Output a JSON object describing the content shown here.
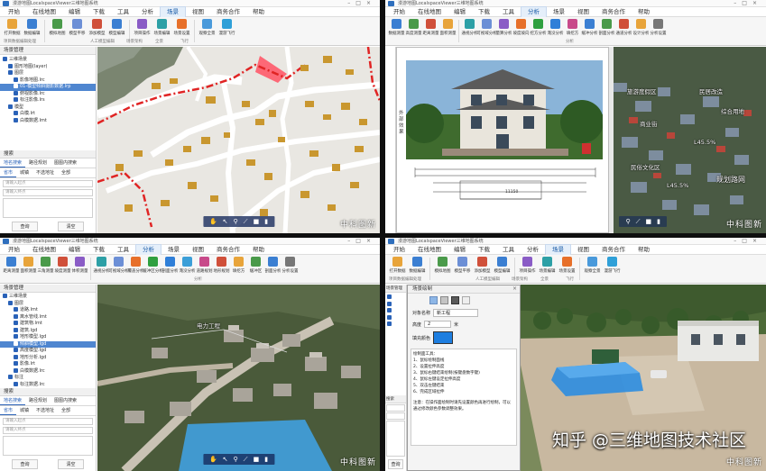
{
  "colors": {
    "accent": "#2a62b8",
    "selection": "#4f86d0",
    "redline": "#e02424"
  },
  "app_title": "漫游地图LocalspaceViewer三维地图系统",
  "menu": [
    "开始",
    "在线地图",
    "编辑",
    "下载",
    "工具",
    "分析",
    "场景",
    "视图",
    "商务合作",
    "帮助"
  ],
  "q1": {
    "active_tab": "场景",
    "ribbon": [
      "打开数据",
      "数据编辑",
      "模拟地图",
      "模型平移",
      "添加模型",
      "模型编辑",
      "项目操作",
      "场景编辑",
      "场景设置",
      "观察全景",
      "漫游飞行"
    ],
    "groups": [
      "项目数据编辑处理",
      "人工模型编辑",
      "场景架构",
      "全景",
      "飞行"
    ],
    "panel_title": "场景管理",
    "tree": [
      "三维场景",
      "图形地图(layer)",
      "图层",
      "影像地图.lrc",
      "01-模型倾斜摄影数据.lrp",
      "俯视影像.lrc",
      "标注影像.lrs",
      "模型",
      "白模.lrt",
      "白模数据.lmt"
    ],
    "selected_index": 4,
    "search_title": "搜索",
    "search_tabs": [
      "地名搜索",
      "路径规划",
      "图图内搜索"
    ],
    "search_sub": [
      "省市",
      "城镇",
      "不选地址",
      "全部"
    ],
    "fields": [
      "请输入起点",
      "请输入终点"
    ],
    "btns": [
      "查询",
      "清空"
    ],
    "nav_icons": [
      "✋",
      "↖",
      "⚲",
      "⟋",
      "■",
      "▮"
    ],
    "watermark": "中科图新"
  },
  "q2": {
    "active_tab": "分析",
    "ribbon": [
      "数据测量",
      "高度测量",
      "距离测量",
      "面积测量",
      "通视分析",
      "可视域分析",
      "量算分析",
      "坡度坡向",
      "挖方分析",
      "淹没分析",
      "填挖方",
      "缓冲分析",
      "剖面分析",
      "通道分析",
      "设计分析",
      "分析设置"
    ],
    "group": "分析",
    "doc_side": "外部效果",
    "drawing_dim": "11150",
    "labels": [
      "旅游度假区",
      "民居改造",
      "商业街",
      "L45.5%",
      "L45.5%",
      "民俗文化区",
      "规划路网",
      "综合用地"
    ],
    "nav_icons": [
      "⚲",
      "⟋",
      "■",
      "▮"
    ],
    "watermark": "中科图新"
  },
  "q3": {
    "active_tab": "分析",
    "ribbon": [
      "距离测量",
      "面积测量",
      "三角测量",
      "坡度测量",
      "体积测量",
      "通视测量",
      "量算",
      "挖方测量",
      "通视分析",
      "可视域分析",
      "覆盖分析",
      "缓冲区分析",
      "剖面分析",
      "淹没分析",
      "道路规划",
      "地形规划",
      "填挖方",
      "缓冲区",
      "剖面分析",
      "分析设置"
    ],
    "group": "分析",
    "panel_title": "场景管理",
    "tree": [
      "三维场景",
      "图层",
      "道路.lmt",
      "离水管线.lmt",
      "建筑物.lmt",
      "建筑.lgd",
      "地形模型.lgd",
      "倾斜模型.lgd",
      "高度模型.lgd",
      "地形分析.lgd",
      "影像.lrt",
      "白模数据.lrc",
      "标注",
      "标注数据.lrc"
    ],
    "selected_index": 7,
    "label": "电力工程",
    "search_title": "搜索",
    "search_tabs": [
      "地名搜索",
      "路径规划",
      "图图内搜索"
    ],
    "search_sub": [
      "省市",
      "城镇",
      "不选地址",
      "全部"
    ],
    "fields": [
      "请输入起点",
      "请输入终点"
    ],
    "btns": [
      "查询",
      "清空"
    ],
    "nav_icons": [
      "✋",
      "↖",
      "⚲",
      "⟋",
      "■",
      "▮"
    ],
    "watermark": "中科图新"
  },
  "q4": {
    "active_tab": "场景",
    "ribbon": [
      "打开数据",
      "数据编辑",
      "模拟地图",
      "模型平移",
      "添加模型",
      "模型编辑",
      "项目操作",
      "场景编辑",
      "场景设置",
      "观察全景",
      "漫游飞行"
    ],
    "groups": [
      "项目数据编辑处理",
      "人工模型编辑",
      "场景架构",
      "全景",
      "飞行"
    ],
    "panel_title": "场景管理",
    "dialog": {
      "title": "场景绘制",
      "name_label": "对象名称",
      "name_value": "新工程",
      "height_label": "高度",
      "height_value": "2",
      "fill_label": "填充颜色",
      "unit": "米",
      "instr_title": "绘制面工具：",
      "steps": [
        "1、鼠标绘制面线",
        "2、设置拉伸高度",
        "3、鼠标右键结束绘制(按键盘数字键)",
        "4、鼠标左键设定拉伸高度",
        "5、双击左键结束",
        "6、完成区域拉伸"
      ],
      "note": "注意：在操作面绘制时请先设置颜色再进行绘制，可以通过修改颜色参数调整效果。"
    },
    "search_title": "搜索",
    "search_tabs": [
      "地名搜索",
      "路径规划",
      "图图内搜索"
    ],
    "search_sub": [
      "省市",
      "城镇",
      "不选地址",
      "全部"
    ],
    "fields": [
      "请输入起点",
      "请输入终点"
    ],
    "btns": [
      "查询",
      "清空"
    ],
    "nav_icons": [
      "✋",
      "↖",
      "⚲",
      "⟋",
      "■",
      "▮"
    ],
    "watermark": "中科图新",
    "overlay": "知乎 @三维地图技术社区"
  }
}
